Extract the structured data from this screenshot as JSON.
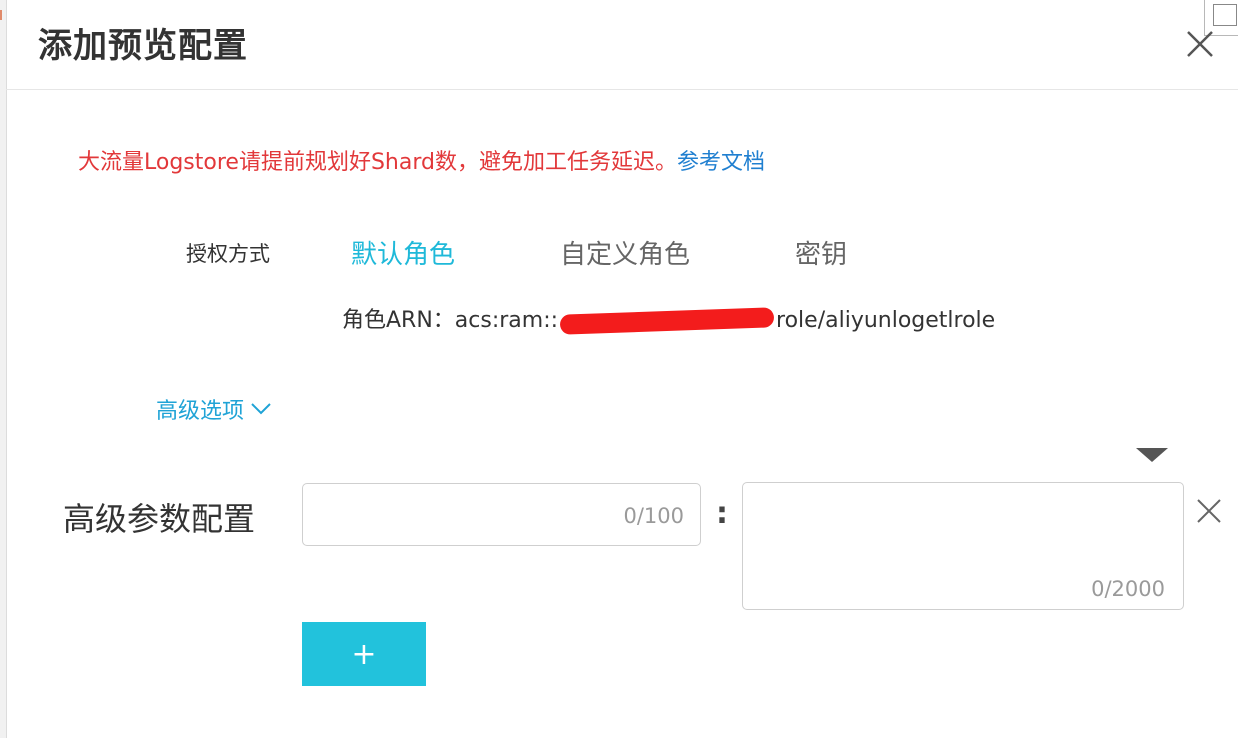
{
  "dialog": {
    "title": "添加预览配置",
    "close_icon": "close-icon"
  },
  "warning": {
    "text": "大流量Logstore请提前规划好Shard数，避免加工任务延迟。",
    "link_label": "参考文档"
  },
  "auth": {
    "label": "授权方式",
    "tabs": [
      {
        "label": "默认角色",
        "active": true
      },
      {
        "label": "自定义角色",
        "active": false
      },
      {
        "label": "密钥",
        "active": false
      }
    ],
    "arn_label": "角色ARN：",
    "arn_prefix": "acs:ram::",
    "arn_suffix": "role/aliyunlogetlrole"
  },
  "advanced": {
    "toggle_label": "高级选项",
    "param_label": "高级参数配置",
    "key_counter": "0/100",
    "separator": ":",
    "value_counter": "0/2000",
    "add_label": "+"
  },
  "colors": {
    "accent": "#22c2dc",
    "active_tab": "#1fb9d9",
    "warning": "#e2383a",
    "link": "#1f7fd0"
  }
}
